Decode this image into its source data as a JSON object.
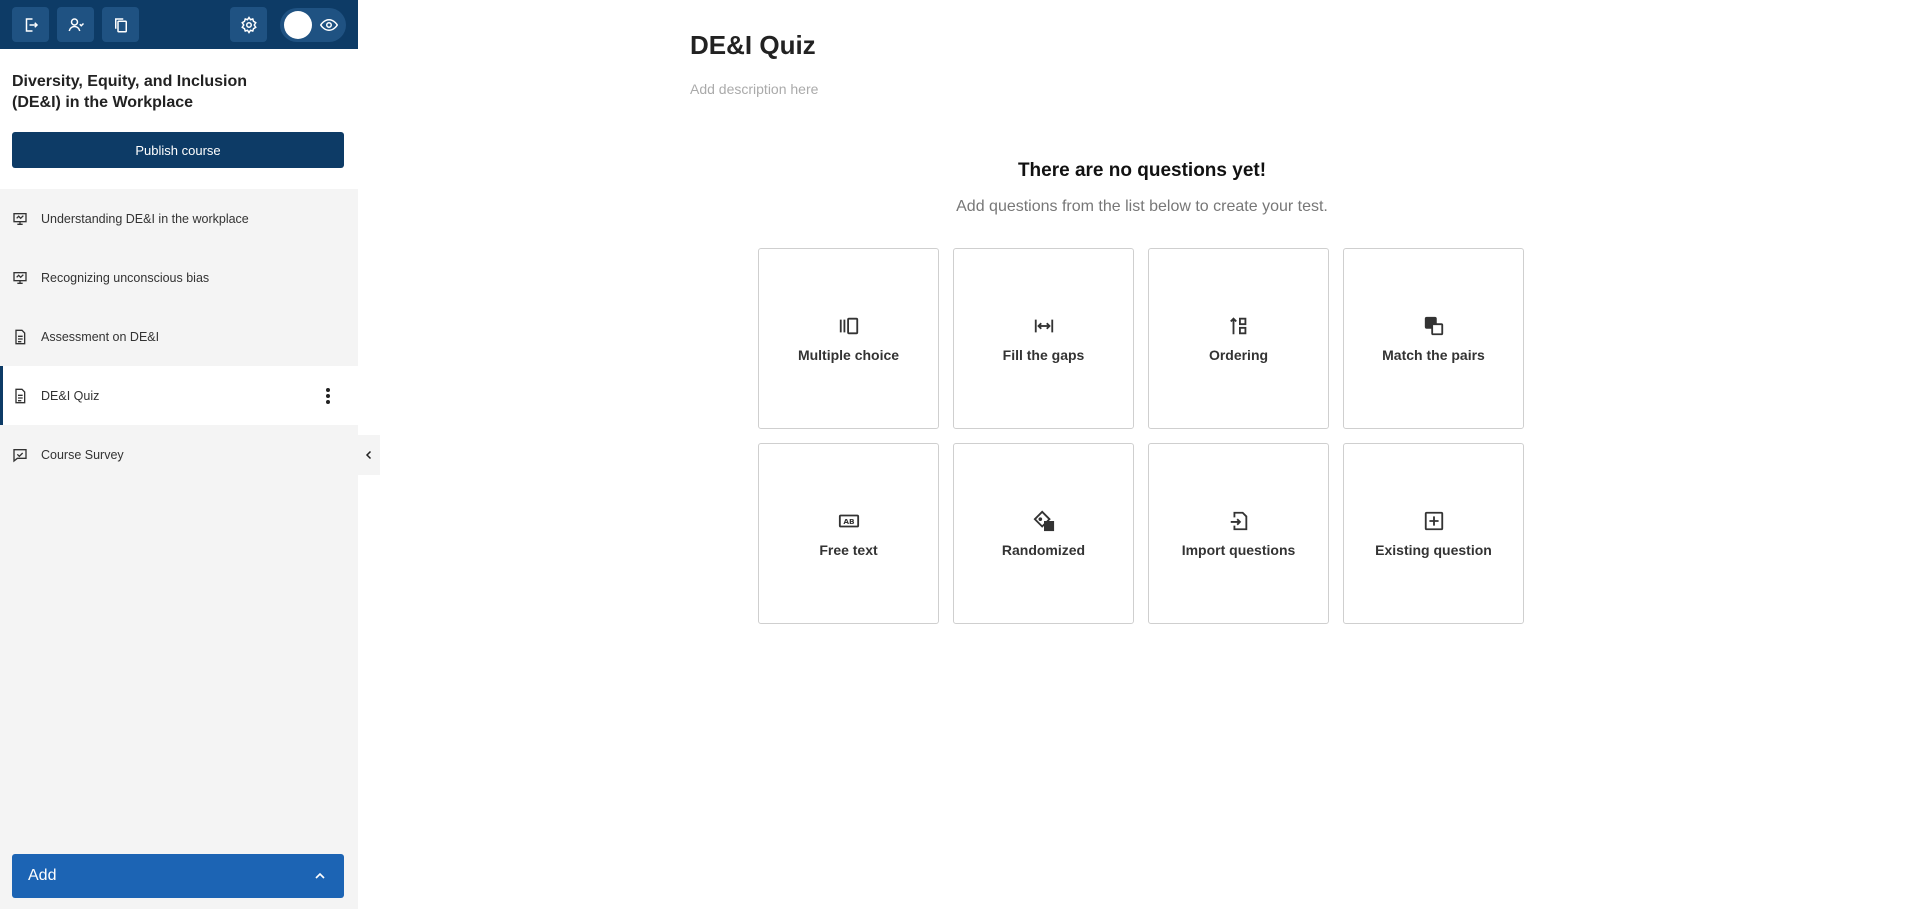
{
  "sidebar": {
    "course_title": "Diversity, Equity, and Inclusion (DE&I) in the Workplace",
    "publish_label": "Publish course",
    "items": [
      {
        "label": "Understanding DE&I in the workplace",
        "icon": "presentation-icon"
      },
      {
        "label": "Recognizing unconscious bias",
        "icon": "presentation-icon"
      },
      {
        "label": "Assessment on DE&I",
        "icon": "document-icon"
      },
      {
        "label": "DE&I Quiz",
        "icon": "document-icon",
        "active": true
      },
      {
        "label": "Course Survey",
        "icon": "survey-icon"
      }
    ],
    "add_label": "Add"
  },
  "toolbar": {
    "icons": [
      "exit-icon",
      "users-icon",
      "copy-icon",
      "gear-icon",
      "eye-icon"
    ]
  },
  "main": {
    "title": "DE&I Quiz",
    "description_placeholder": "Add description here",
    "empty_title": "There are no questions yet!",
    "empty_subtitle": "Add questions from the list below to create your test.",
    "question_types": [
      {
        "label": "Multiple choice",
        "icon": "multiple-choice-icon"
      },
      {
        "label": "Fill the gaps",
        "icon": "fill-gaps-icon"
      },
      {
        "label": "Ordering",
        "icon": "ordering-icon"
      },
      {
        "label": "Match the pairs",
        "icon": "match-pairs-icon"
      },
      {
        "label": "Free text",
        "icon": "free-text-icon"
      },
      {
        "label": "Randomized",
        "icon": "randomized-icon"
      },
      {
        "label": "Import questions",
        "icon": "import-icon"
      },
      {
        "label": "Existing question",
        "icon": "add-existing-icon"
      }
    ]
  },
  "colors": {
    "primary": "#0d3b66",
    "add_button": "#1c64b4",
    "sidebar_bg": "#f4f4f4"
  }
}
